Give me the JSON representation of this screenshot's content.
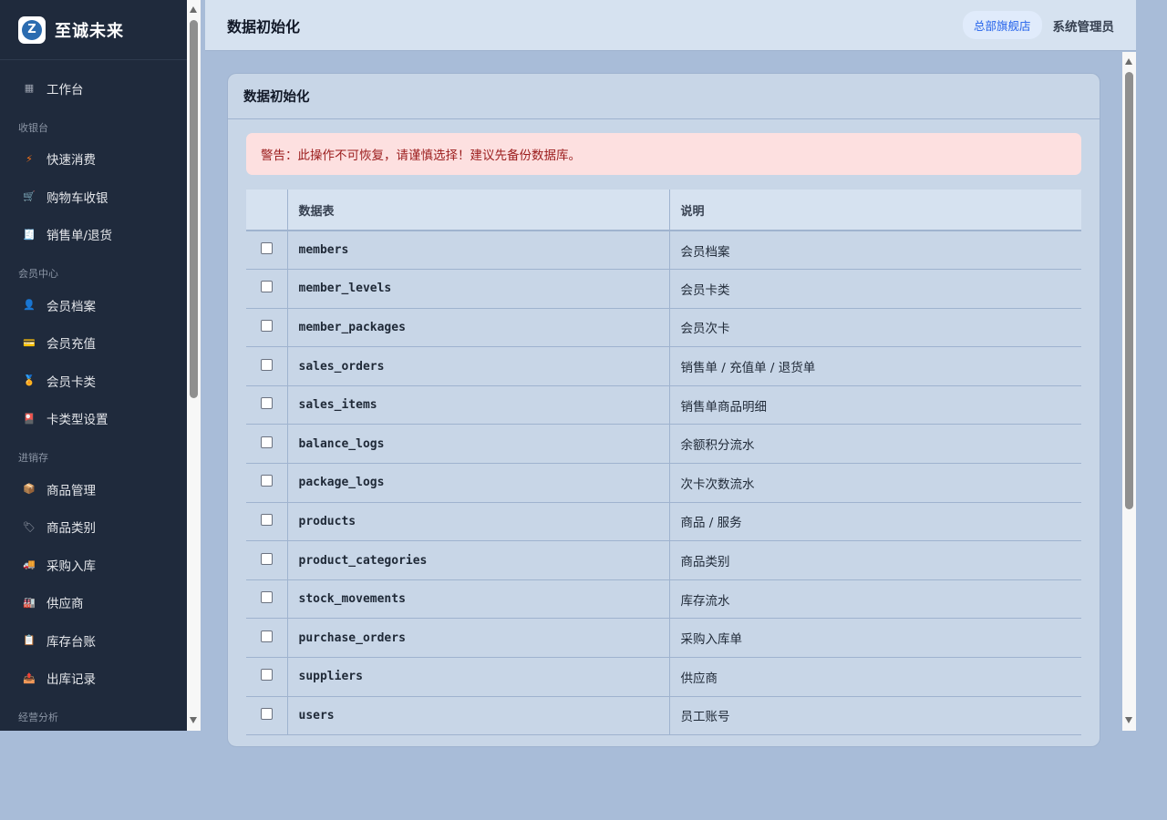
{
  "app": {
    "brand": "至诚未来",
    "logo_letter": "Z"
  },
  "sidebar": {
    "sections": [
      {
        "type": "item",
        "icon": "grid-icon",
        "glyph": "▦",
        "color": "#9ca3af",
        "label": "工作台"
      },
      {
        "type": "group",
        "label": "收银台"
      },
      {
        "type": "item",
        "icon": "lightning-icon",
        "glyph": "⚡",
        "color": "#f97316",
        "label": "快速消费"
      },
      {
        "type": "item",
        "icon": "cart-icon",
        "glyph": "🛒",
        "color": "#9ca3af",
        "label": "购物车收银"
      },
      {
        "type": "item",
        "icon": "receipt-icon",
        "glyph": "🧾",
        "color": "#d1d5db",
        "label": "销售单/退货"
      },
      {
        "type": "group",
        "label": "会员中心"
      },
      {
        "type": "item",
        "icon": "user-icon",
        "glyph": "👤",
        "color": "#d1d5db",
        "label": "会员档案"
      },
      {
        "type": "item",
        "icon": "card-icon",
        "glyph": "💳",
        "color": "#60a5fa",
        "label": "会员充值"
      },
      {
        "type": "item",
        "icon": "medal-icon",
        "glyph": "🏅",
        "color": "#f59e0b",
        "label": "会员卡类"
      },
      {
        "type": "item",
        "icon": "card-type-icon",
        "glyph": "🎴",
        "color": "#ec4899",
        "label": "卡类型设置"
      },
      {
        "type": "group",
        "label": "进销存"
      },
      {
        "type": "item",
        "icon": "box-icon",
        "glyph": "📦",
        "color": "#d97706",
        "label": "商品管理"
      },
      {
        "type": "item",
        "icon": "tag-icon",
        "glyph": "🏷",
        "color": "#9ca3af",
        "label": "商品类别"
      },
      {
        "type": "item",
        "icon": "truck-icon",
        "glyph": "🚚",
        "color": "#f59e0b",
        "label": "采购入库"
      },
      {
        "type": "item",
        "icon": "factory-icon",
        "glyph": "🏭",
        "color": "#9ca3af",
        "label": "供应商"
      },
      {
        "type": "item",
        "icon": "clipboard-icon",
        "glyph": "📋",
        "color": "#d1d5db",
        "label": "库存台账"
      },
      {
        "type": "item",
        "icon": "outbox-icon",
        "glyph": "📤",
        "color": "#3b82f6",
        "label": "出库记录"
      },
      {
        "type": "group",
        "label": "经营分析"
      }
    ]
  },
  "header": {
    "title": "数据初始化",
    "store": "总部旗舰店",
    "user": "系统管理员"
  },
  "card": {
    "title": "数据初始化",
    "warning": "警告：此操作不可恢复，请谨慎选择！建议先备份数据库。",
    "columns": [
      "",
      "数据表",
      "说明"
    ],
    "rows": [
      {
        "table": "members",
        "desc": "会员档案"
      },
      {
        "table": "member_levels",
        "desc": "会员卡类"
      },
      {
        "table": "member_packages",
        "desc": "会员次卡"
      },
      {
        "table": "sales_orders",
        "desc": "销售单 / 充值单 / 退货单"
      },
      {
        "table": "sales_items",
        "desc": "销售单商品明细"
      },
      {
        "table": "balance_logs",
        "desc": "余额积分流水"
      },
      {
        "table": "package_logs",
        "desc": "次卡次数流水"
      },
      {
        "table": "products",
        "desc": "商品 / 服务"
      },
      {
        "table": "product_categories",
        "desc": "商品类别"
      },
      {
        "table": "stock_movements",
        "desc": "库存流水"
      },
      {
        "table": "purchase_orders",
        "desc": "采购入库单"
      },
      {
        "table": "suppliers",
        "desc": "供应商"
      },
      {
        "table": "users",
        "desc": "员工账号"
      }
    ]
  }
}
